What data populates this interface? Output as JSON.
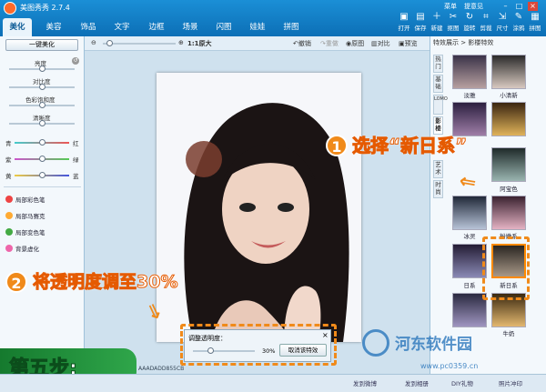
{
  "window": {
    "title": "美图秀秀 2.7.4",
    "menu": "菜单",
    "feedback": "提意见"
  },
  "tabs": [
    "美化",
    "美容",
    "饰品",
    "文字",
    "边框",
    "场景",
    "闪图",
    "娃娃",
    "拼图"
  ],
  "toolbar": [
    "打开",
    "保存",
    "新建",
    "抠图",
    "旋转",
    "剪裁",
    "尺寸",
    "涂鸦",
    "拼图"
  ],
  "left": {
    "onekey": "一键美化",
    "sliders": [
      "亮度",
      "对比度",
      "色彩饱和度",
      "清晰度"
    ],
    "colors": [
      {
        "a": "青",
        "b": "红"
      },
      {
        "a": "紫",
        "b": "绿"
      },
      {
        "a": "黄",
        "b": "蓝"
      }
    ],
    "tools": [
      "局部彩色笔",
      "局部马赛克",
      "局部变色笔",
      "背景虚化"
    ]
  },
  "canvas_toolbar": {
    "zoom_label": "1:1原大",
    "undo": "撤销",
    "redo": "重做",
    "original": "原图",
    "compare": "对比",
    "preview": "预览"
  },
  "right": {
    "header": "特效展示 > 影楼特效",
    "vtabs": [
      "热门",
      "基础",
      "LOMO",
      "影楼",
      "艺术",
      "时尚"
    ],
    "thumbs": [
      "淡雅",
      "小清新",
      "",
      "",
      "",
      "阿宝色",
      "冰灵",
      "粉嫩系",
      "日系",
      "新日系",
      "",
      "牛奶"
    ]
  },
  "dialog": {
    "title": "调整透明度：",
    "value": "30%",
    "cancel": "取消该特效"
  },
  "annotations": {
    "step1_num": "1",
    "step1": "选择“新日系”",
    "step2_num": "2",
    "step2": "将透明度调至30%",
    "step5": "第五步:"
  },
  "status": {
    "left": "发到微博",
    "mid": "发到相册",
    "diy": "DIY礼物",
    "photo": "照片冲印",
    "fname": "AAADADD855CB"
  },
  "watermark": {
    "name": "河东软件园",
    "url": "www.pc0359.cn"
  },
  "colors": {
    "accent": "#0c6fb6",
    "orange": "#f08a1a"
  }
}
